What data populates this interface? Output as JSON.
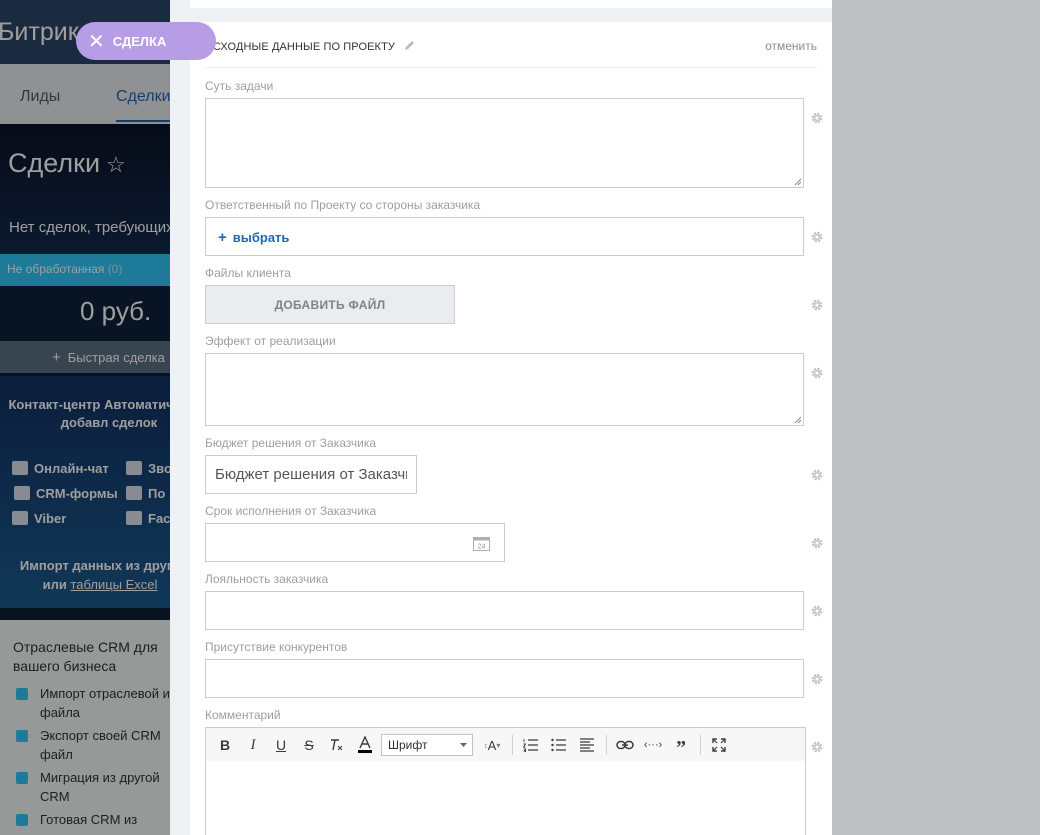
{
  "background": {
    "logo": "Битрикс",
    "close_button_label": "СДЕЛКА",
    "tabs": [
      "Лиды",
      "Сделки"
    ],
    "page_title": "Сделки",
    "no_deals_text": "Нет сделок, требующих",
    "stage_name": "Не обработанная",
    "stage_count": "(0)",
    "stage_sum": "0 руб.",
    "quick_deal": "Быстрая сделка",
    "contact_center_title": "Контакт-центр Автоматическое добавл сделок",
    "channels": [
      "Онлайн-чат",
      "Зво",
      "CRM-формы",
      "По",
      "Viber",
      "Fac"
    ],
    "import_text": "Импорт данных из друго",
    "import_text_or": "или",
    "import_link": "таблицы Excel",
    "industry_title": "Отраслевые CRM для вашего бизнеса",
    "industry_items": [
      "Импорт отраслевой из файла",
      "Экспорт своей CRM файл",
      "Миграция из другой CRM",
      "Готовая CRM из"
    ]
  },
  "section": {
    "title": "ИСХОДНЫЕ ДАННЫЕ ПО ПРОЕКТУ",
    "cancel_label": "отменить"
  },
  "fields": {
    "task_essence_label": "Суть задачи",
    "responsible_label": "Ответственный по Проекту со стороны заказчика",
    "responsible_select": "выбрать",
    "client_files_label": "Файлы клиента",
    "add_file_button": "ДОБАВИТЬ ФАЙЛ",
    "effect_label": "Эффект от реализации",
    "budget_label": "Бюджет решения от Заказчика",
    "budget_placeholder": "Бюджет решения от Заказчика",
    "deadline_label": "Срок исполнения от Заказчика",
    "calendar_day": "24",
    "loyalty_label": "Лояльность заказчика",
    "competitors_label": "Присутствие конкурентов",
    "comment_label": "Комментарий"
  },
  "editor": {
    "bold": "B",
    "italic": "I",
    "underline": "U",
    "strike": "S",
    "font_select": "Шрифт",
    "font_size": "A"
  }
}
